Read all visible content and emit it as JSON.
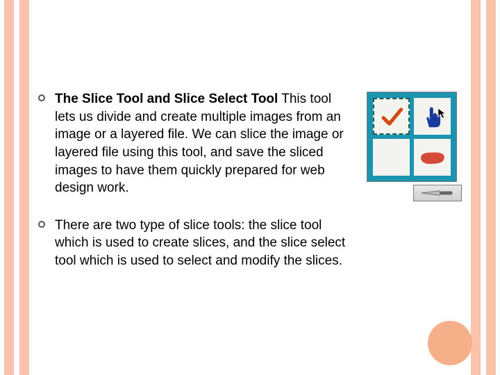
{
  "bullets": [
    {
      "title": "The Slice Tool and Slice Select Tool",
      "body": "This tool lets us divide and create multiple images from an image or a layered file. We can slice the image or layered file using this tool, and save the sliced images to have them quickly prepared for web design work."
    },
    {
      "title": "",
      "body": "There are two type of slice tools: the slice tool which is used to create slices, and the slice select tool which is used to select and modify the slices."
    }
  ]
}
